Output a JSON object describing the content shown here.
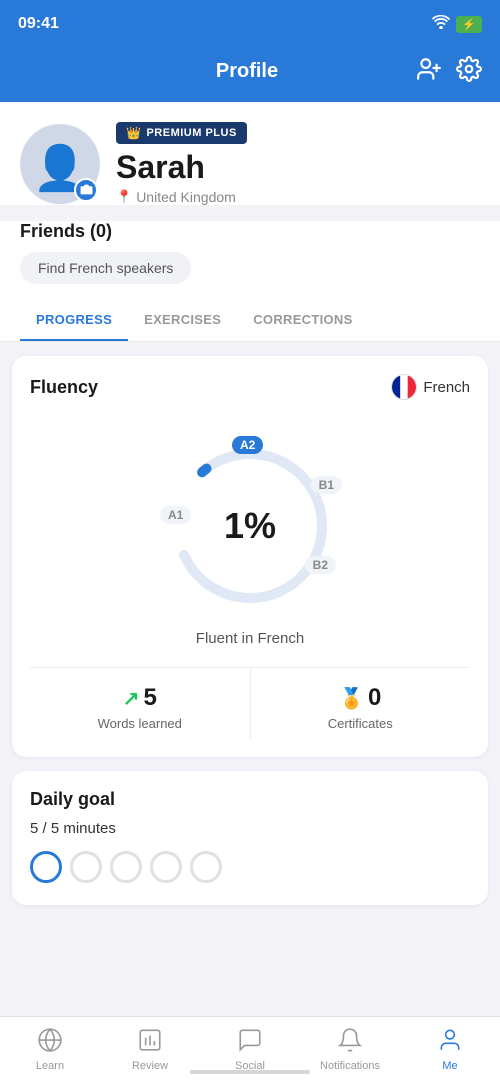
{
  "statusBar": {
    "time": "09:41"
  },
  "header": {
    "title": "Profile",
    "addFriendLabel": "add-friend",
    "settingsLabel": "settings"
  },
  "profile": {
    "premiumBadge": "PREMIUM PLUS",
    "name": "Sarah",
    "location": "United Kingdom"
  },
  "friends": {
    "title": "Friends (0)",
    "findButton": "Find French speakers"
  },
  "tabs": [
    {
      "label": "PROGRESS",
      "active": true
    },
    {
      "label": "EXERCISES",
      "active": false
    },
    {
      "label": "CORRECTIONS",
      "active": false
    }
  ],
  "fluencyCard": {
    "title": "Fluency",
    "language": "French",
    "percent": "1%",
    "subtitle": "Fluent in French",
    "levels": {
      "a1": "A1",
      "a2": "A2",
      "b1": "B1",
      "b2": "B2"
    }
  },
  "stats": {
    "wordsLearned": {
      "value": "5",
      "label": "Words learned"
    },
    "certificates": {
      "value": "0",
      "label": "Certificates"
    }
  },
  "dailyGoal": {
    "title": "Daily goal",
    "value": "5 / 5 minutes"
  },
  "bottomNav": [
    {
      "label": "Learn",
      "icon": "🌐",
      "active": false
    },
    {
      "label": "Review",
      "icon": "📊",
      "active": false
    },
    {
      "label": "Social",
      "icon": "💬",
      "active": false
    },
    {
      "label": "Notifications",
      "icon": "🔔",
      "active": false
    },
    {
      "label": "Me",
      "icon": "👤",
      "active": true
    }
  ]
}
